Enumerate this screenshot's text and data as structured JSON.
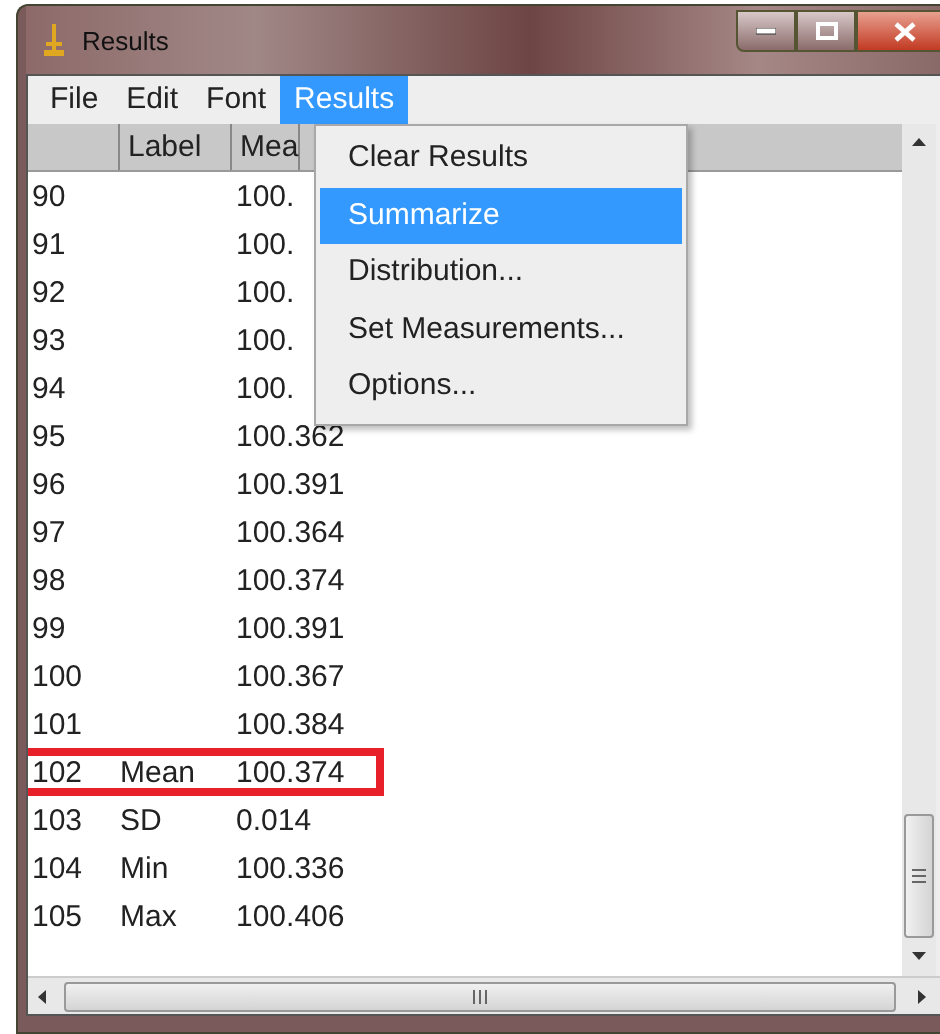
{
  "window": {
    "title": "Results"
  },
  "menubar": [
    {
      "label": "File",
      "selected": false
    },
    {
      "label": "Edit",
      "selected": false
    },
    {
      "label": "Font",
      "selected": false
    },
    {
      "label": "Results",
      "selected": true
    }
  ],
  "menu": {
    "items": [
      {
        "label": "Clear Results",
        "selected": false
      },
      {
        "label": "Summarize",
        "selected": true
      },
      {
        "label": "Distribution...",
        "selected": false
      },
      {
        "label": "Set Measurements...",
        "selected": false
      },
      {
        "label": "Options...",
        "selected": false
      }
    ]
  },
  "table": {
    "columns": [
      "Label",
      "Mea"
    ],
    "rows": [
      {
        "index": "90",
        "label": "",
        "mean": "100.",
        "highlighted": false
      },
      {
        "index": "91",
        "label": "",
        "mean": "100.",
        "highlighted": false
      },
      {
        "index": "92",
        "label": "",
        "mean": "100.",
        "highlighted": false
      },
      {
        "index": "93",
        "label": "",
        "mean": "100.",
        "highlighted": false
      },
      {
        "index": "94",
        "label": "",
        "mean": "100.",
        "highlighted": false
      },
      {
        "index": "95",
        "label": "",
        "mean": "100.362",
        "highlighted": false
      },
      {
        "index": "96",
        "label": "",
        "mean": "100.391",
        "highlighted": false
      },
      {
        "index": "97",
        "label": "",
        "mean": "100.364",
        "highlighted": false
      },
      {
        "index": "98",
        "label": "",
        "mean": "100.374",
        "highlighted": false
      },
      {
        "index": "99",
        "label": "",
        "mean": "100.391",
        "highlighted": false
      },
      {
        "index": "100",
        "label": "",
        "mean": "100.367",
        "highlighted": false
      },
      {
        "index": "101",
        "label": "",
        "mean": "100.384",
        "highlighted": false
      },
      {
        "index": "102",
        "label": "Mean",
        "mean": "100.374",
        "highlighted": true
      },
      {
        "index": "103",
        "label": "SD",
        "mean": "0.014",
        "highlighted": false
      },
      {
        "index": "104",
        "label": "Min",
        "mean": "100.336",
        "highlighted": false
      },
      {
        "index": "105",
        "label": "Max",
        "mean": "100.406",
        "highlighted": false
      }
    ]
  }
}
